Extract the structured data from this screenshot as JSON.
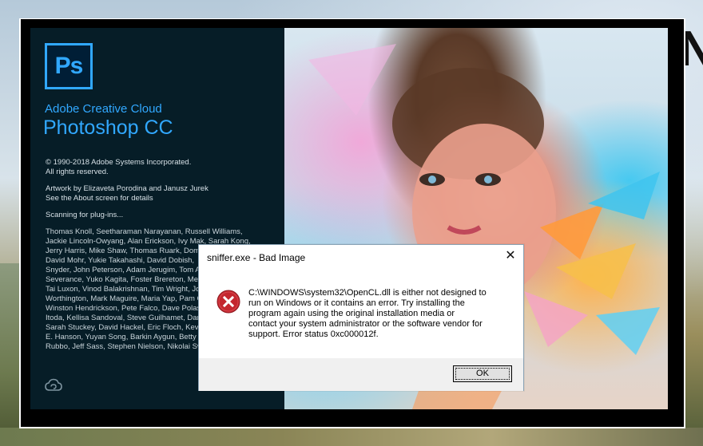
{
  "splash": {
    "logo_text": "Ps",
    "brand_line1": "Adobe Creative Cloud",
    "brand_line2": "Photoshop CC",
    "copyright": "© 1990-2018 Adobe Systems Incorporated.",
    "rights": "All rights reserved.",
    "artwork": "Artwork by Elizaveta Porodina and Janusz Jurek",
    "about": "See the About screen for details",
    "status": "Scanning for plug-ins...",
    "credits": "Thomas Knoll, Seetharaman Narayanan, Russell Williams,\nJackie Lincoln-Owyang, Alan Erickson, Ivy Mak, Sarah Kong,\nJerry Harris, Mike Shaw, Thomas Ruark, Dom\nDavid Mohr, Yukie Takahashi, David Dobish,\nSnyder, John Peterson, Adam Jerugim, Tom A\nSeverance, Yuko Kagita, Foster Brereton, Mer\nTai Luxon, Vinod Balakrishnan, Tim Wright, Jo\nWorthington, Mark Maguire, Maria Yap, Pam C\nWinston Hendrickson, Pete Falco, Dave Polasc\nItoda, Kellisa Sandoval, Steve Guilhamet, Dar\nSarah Stuckey, David Hackel, Eric Floch, Kev\nE. Hanson, Yuyan Song, Barkin Aygun, Betty\nRubbo, Jeff Sass, Stephen Nielson, Nikolai Sv"
  },
  "dialog": {
    "title": "sniffer.exe - Bad Image",
    "close_glyph": "✕",
    "message": "C:\\WINDOWS\\system32\\OpenCL.dll is either not designed to\nrun on Windows or it contains an error. Try installing the\nprogram again using the original installation media or\ncontact your system administrator or the software vendor for\nsupport. Error status 0xc000012f.",
    "ok_label": "OK",
    "icon": "error-icon"
  },
  "desktop": {
    "partial_text": "N"
  },
  "colors": {
    "ps_blue": "#31a8ff",
    "splash_bg": "#061d27",
    "error_red": "#c4262e"
  }
}
